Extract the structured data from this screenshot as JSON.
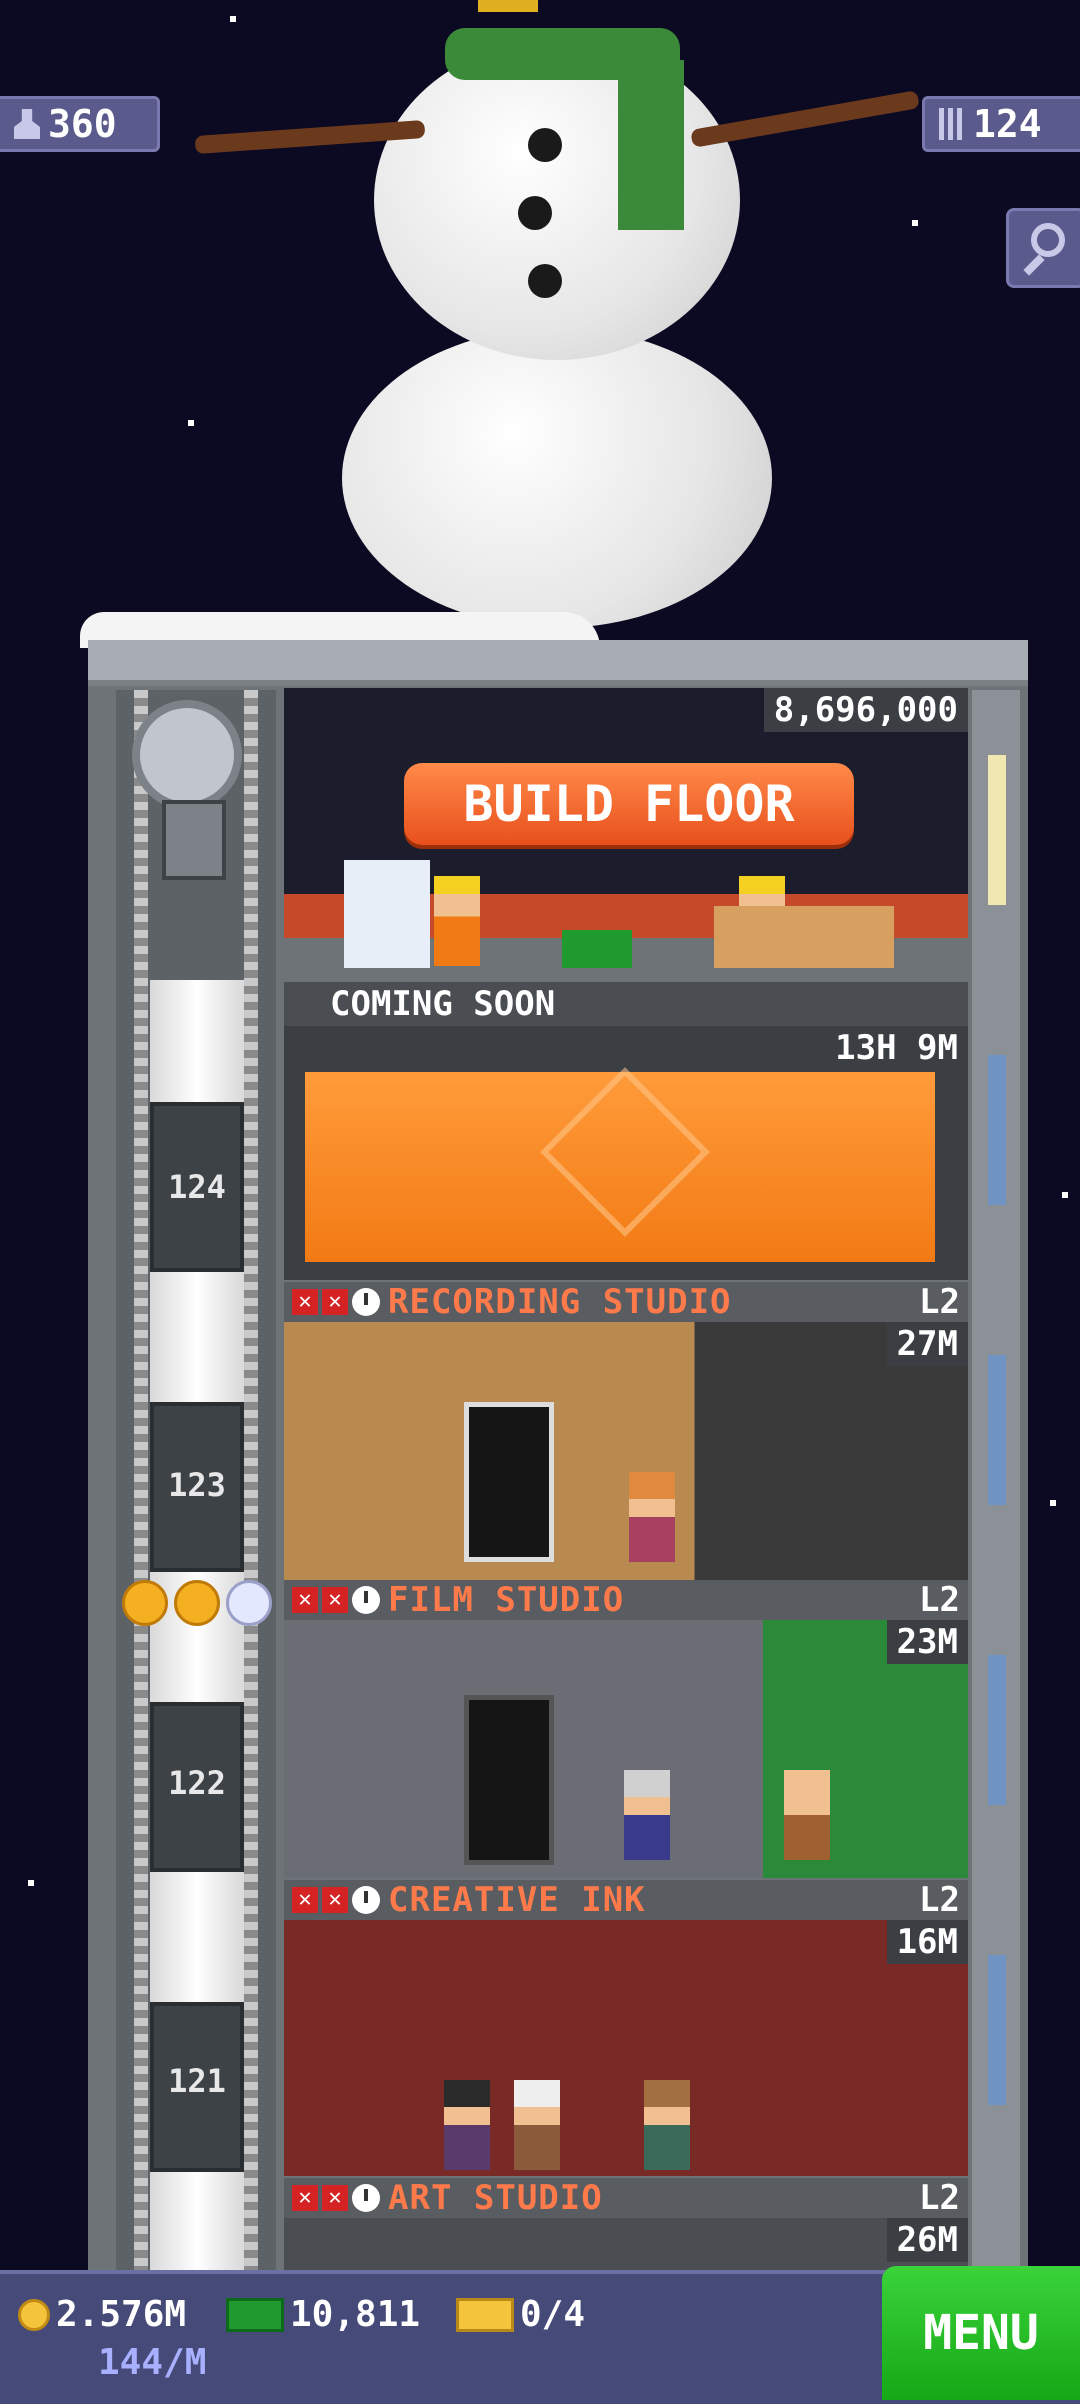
{
  "top": {
    "population": "360",
    "floors": "124"
  },
  "build": {
    "price": "8,696,000",
    "button_label": "BUILD FLOOR",
    "coming_soon": "COMING SOON"
  },
  "construction": {
    "timer": "13H 9M",
    "floor_number": "124"
  },
  "floors": [
    {
      "name": "RECORDING STUDIO",
      "level": "L2",
      "price": "27M",
      "number": "123"
    },
    {
      "name": "FILM STUDIO",
      "level": "L2",
      "price": "23M",
      "number": "122"
    },
    {
      "name": "CREATIVE INK",
      "level": "L2",
      "price": "16M",
      "number": "121"
    },
    {
      "name": "ART STUDIO",
      "level": "L2",
      "price": "26M"
    }
  ],
  "bottom": {
    "coins": "2.576M",
    "rate": "144/M",
    "bux": "10,811",
    "tickets": "0/4",
    "menu_label": "MENU"
  },
  "colors": {
    "sky": "#0c0a22",
    "floor_name": "#ff7a4a",
    "build_button": "#e8501c",
    "menu_button": "#16a816"
  }
}
